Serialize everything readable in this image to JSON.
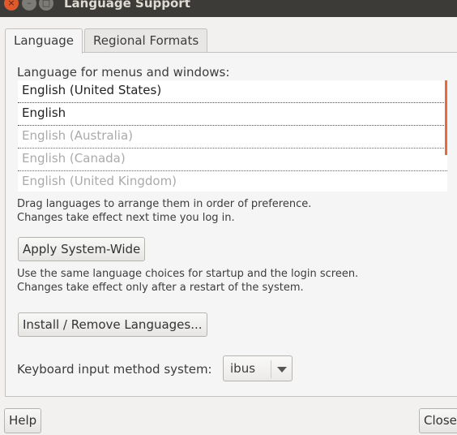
{
  "window": {
    "title": "Language Support",
    "close": "×",
    "minimize": "–",
    "maximize": "□"
  },
  "tabs": [
    {
      "label": "Language"
    },
    {
      "label": "Regional Formats"
    }
  ],
  "language": {
    "list_label": "Language for menus and windows:",
    "languages": [
      {
        "label": "English (United States)",
        "active": true
      },
      {
        "label": "English",
        "active": true
      },
      {
        "label": "English (Australia)",
        "active": false
      },
      {
        "label": "English (Canada)",
        "active": false
      },
      {
        "label": "English (United Kingdom)",
        "active": false
      }
    ],
    "drag_hint_1": "Drag languages to arrange them in order of preference.",
    "drag_hint_2": "Changes take effect next time you log in.",
    "apply_button": "Apply System-Wide",
    "apply_hint_1": "Use the same language choices for startup and the login screen.",
    "apply_hint_2": "Changes take effect only after a restart of the system.",
    "install_button": "Install / Remove Languages...",
    "input_method_label": "Keyboard input method system:",
    "input_method_value": "ibus"
  },
  "footer": {
    "help": "Help",
    "close": "Close"
  },
  "colors": {
    "accent": "#e86a3a",
    "titlebar": "#3c3b37"
  }
}
